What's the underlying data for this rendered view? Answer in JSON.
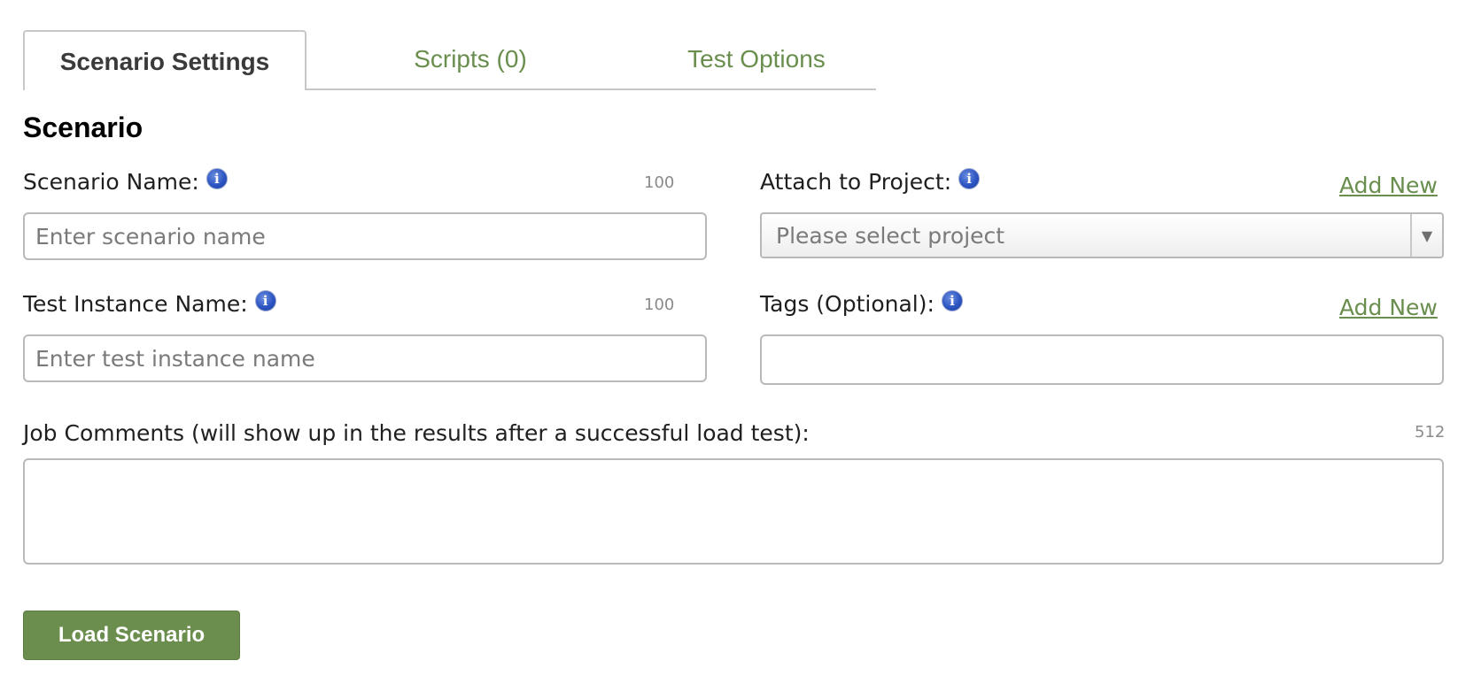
{
  "tabs": [
    {
      "label": "Scenario Settings",
      "active": true
    },
    {
      "label": "Scripts (0)",
      "active": false
    },
    {
      "label": "Test Options",
      "active": false
    }
  ],
  "section": {
    "title": "Scenario"
  },
  "scenario_name": {
    "label": "Scenario Name:",
    "counter": "100",
    "placeholder": "Enter scenario name",
    "value": ""
  },
  "attach_project": {
    "label": "Attach to Project:",
    "add_new": "Add New",
    "selected": "Please select project"
  },
  "test_instance": {
    "label": "Test Instance Name:",
    "counter": "100",
    "placeholder": "Enter test instance name",
    "value": ""
  },
  "tags": {
    "label": "Tags (Optional):",
    "add_new": "Add New",
    "value": ""
  },
  "job_comments": {
    "label": "Job Comments (will show up in the results after a successful load test):",
    "counter": "512",
    "value": ""
  },
  "load_button": {
    "label": "Load Scenario"
  },
  "icons": {
    "info": "i",
    "dropdown": "▼"
  },
  "colors": {
    "accent": "#6b8e4e",
    "tab_link": "#6a8e4e",
    "info_icon": "#2c55c2"
  }
}
